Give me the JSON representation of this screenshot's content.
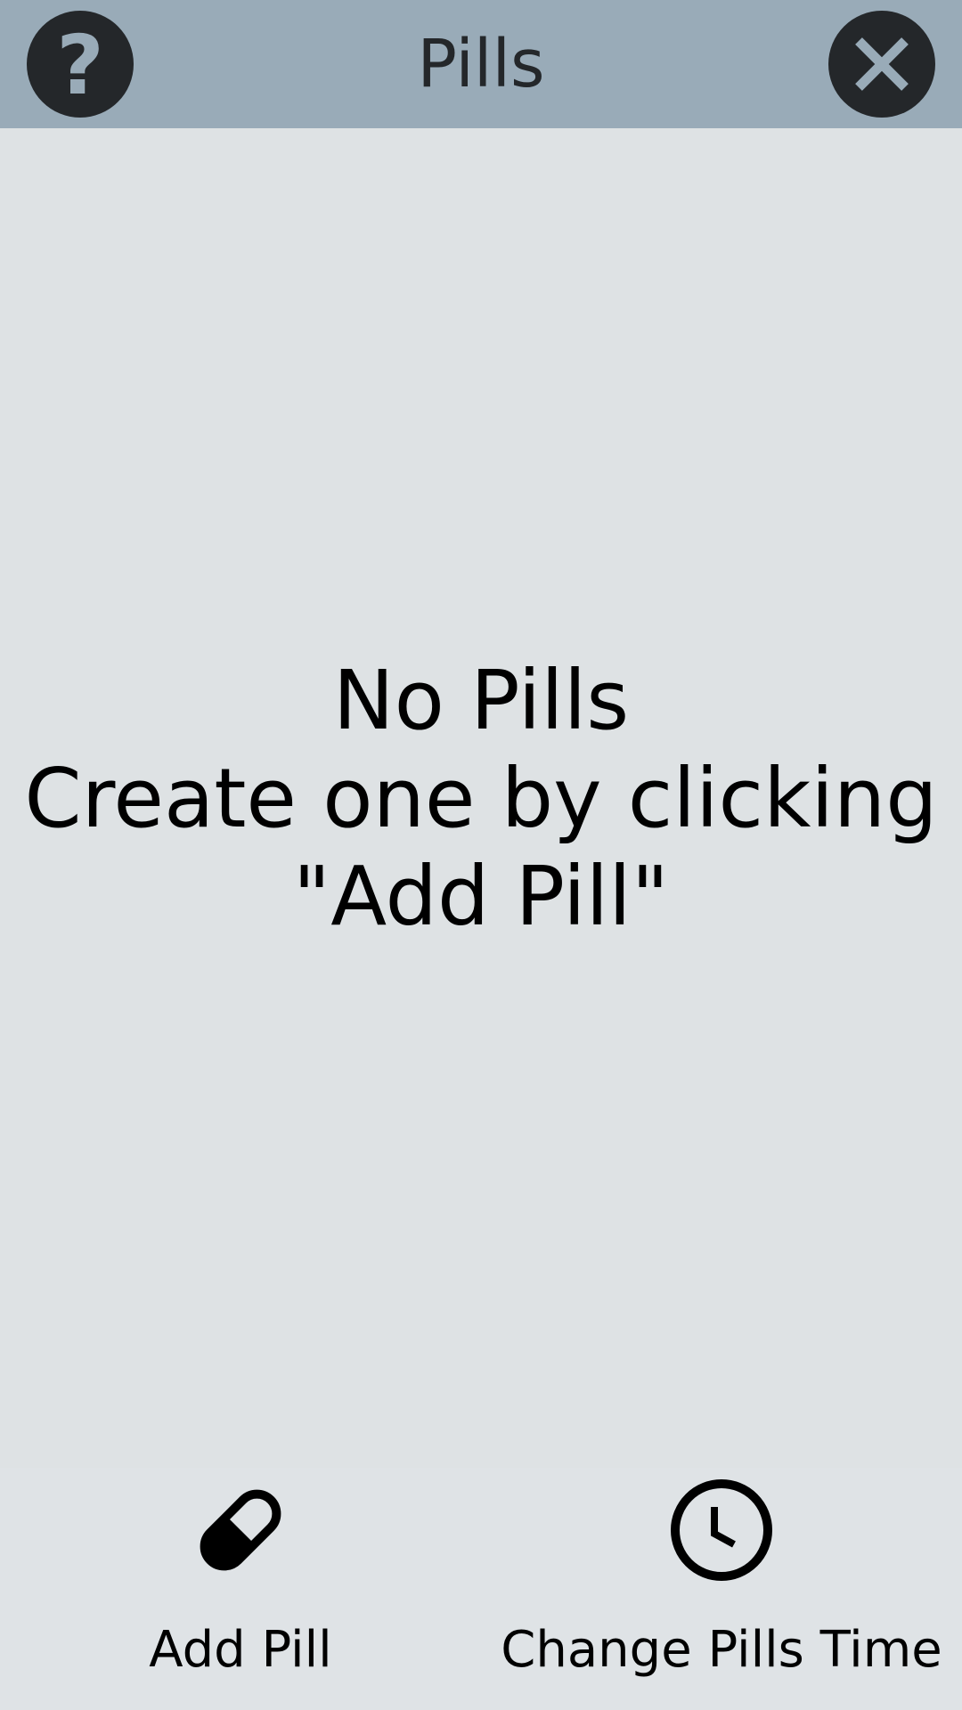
{
  "header": {
    "title": "Pills",
    "help_icon": "question-mark-icon",
    "close_icon": "close-icon",
    "help_glyph": "?",
    "background_color": "#99abb8",
    "button_color": "#24272a"
  },
  "empty_state": {
    "line1": "No Pills",
    "line2": "Create one by clicking",
    "line3": "\"Add Pill\""
  },
  "bottom_bar": {
    "add_pill": {
      "label": "Add Pill",
      "icon": "pill-icon"
    },
    "change_time": {
      "label": "Change Pills Time",
      "icon": "clock-icon"
    }
  },
  "colors": {
    "page_background": "#dee2e4",
    "text": "#000000"
  }
}
